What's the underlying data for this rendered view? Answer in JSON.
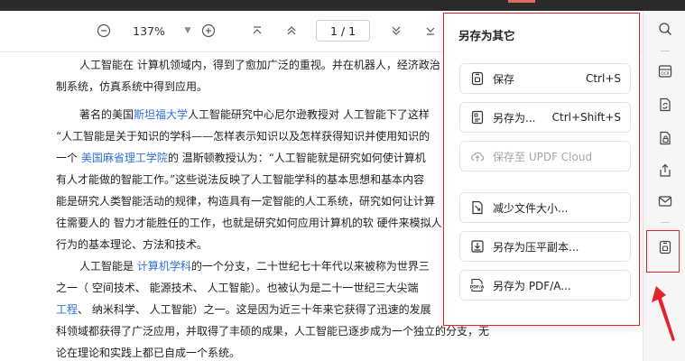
{
  "toolbar": {
    "zoom_value": "137%",
    "page_indicator": "1 / 1"
  },
  "document": {
    "p1": [
      "人工智能在 计算机领域内，得到了愈加广泛的重视。并在机器人，经济政治",
      "制系统，仿真系统中得到应用。"
    ],
    "p2": {
      "l1_a": "著名的美国",
      "l1_link": "斯坦福大学",
      "l1_b": "人工智能研究中心尼尔逊教授对 人工智能下了这样",
      "l2": "“人工智能是关于知识的学科——怎样表示知识以及怎样获得知识并使用知识的",
      "l3_a": "一个 ",
      "l3_link": "美国麻省理工学院",
      "l3_b": "的 温斯顿教授认为：“人工智能就是研究如何使计算机",
      "l4": "有人才能做的智能工作。”这些说法反映了人工智能学科的基本思想和基本内容",
      "l5": "能是研究人类智能活动的规律，构造具有一定智能的人工系统，研究如何让计算",
      "l6": "往需要人的 智力才能胜任的工作，也就是研究如何应用计算机的软 硬件来模拟人",
      "l7": "行为的基本理论、方法和技术。"
    },
    "p3": {
      "l1_a": "人工智能是 ",
      "l1_link": "计算机学科",
      "l1_b": "的一个分支，二十世纪七十年代以来被称为世界三",
      "l2": "之一（ 空间技术、 能源技术、 人工智能）。也被认为是二十一世纪三大尖端",
      "l3_link": "工程",
      "l3_b": "、 纳米科学、 人工智能）之一。这是因为近三十年来它获得了迅速的发展",
      "l4": "科领域都获得了广泛应用，并取得了丰硕的成果，人工智能已逐步成为一个独立的分支，无",
      "l5": "论在理论和实践上都已自成一个系统。"
    }
  },
  "popup": {
    "title": "另存为其它",
    "items": [
      {
        "label": "保存",
        "shortcut": "Ctrl+S",
        "icon": "save-icon"
      },
      {
        "label": "另存为...",
        "shortcut": "Ctrl+Shift+S",
        "icon": "save-as-icon"
      },
      {
        "label": "保存至 UPDF Cloud",
        "shortcut": "",
        "icon": "cloud-icon"
      },
      {
        "label": "减少文件大小...",
        "shortcut": "",
        "icon": "reduce-size-icon"
      },
      {
        "label": "另存为压平副本...",
        "shortcut": "",
        "icon": "flatten-icon"
      },
      {
        "label": "另存为 PDF/A...",
        "shortcut": "",
        "icon": "pdfa-icon"
      }
    ]
  },
  "colors": {
    "accent_red": "#e3242b",
    "link_blue": "#2f6fd6"
  }
}
